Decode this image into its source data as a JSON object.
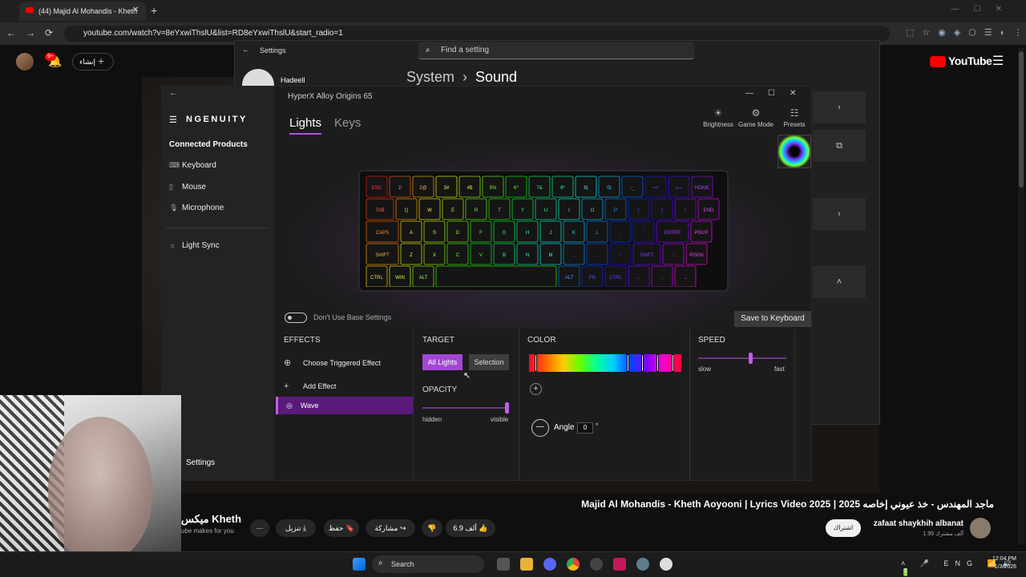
{
  "browser": {
    "tab_title": "(44) Majid Al Mohandis - Kheth",
    "url": "youtube.com/watch?v=8eYxwiThslU&list=RD8eYxwiThslU&start_radio=1"
  },
  "youtube": {
    "logo": "YouTube",
    "create_label": "إنشاء",
    "notif_count": "9+",
    "video_title": "Majid Al Mohandis - Kheth Aoyooni | Lyrics Video 2025 | ماجد المهندس - خذ عيوني إخاصه 2025",
    "channel_name": "zafaat shaykhih albanat",
    "channel_subs": "1.99 ألف مشترك",
    "subscribe": "اشتراك",
    "likes": "6.9 ألف",
    "share": "مشاركة",
    "save": "حفظ",
    "download": "تنزيل",
    "mix_title": "ميكس Kheth",
    "mix_sub": "ube makes for you"
  },
  "settings": {
    "title": "Settings",
    "search_placeholder": "Find a setting",
    "user": "Hadeell",
    "crumb_parent": "System",
    "crumb_current": "Sound"
  },
  "ngenuity": {
    "brand": "NGENUITY",
    "window_title": "HyperX Alloy Origins 65",
    "connected_products": "Connected Products",
    "nav": [
      {
        "label": "Keyboard",
        "icon": "keyboard-icon"
      },
      {
        "label": "Mouse",
        "icon": "mouse-icon"
      },
      {
        "label": "Microphone",
        "icon": "microphone-icon"
      },
      {
        "label": "Light Sync",
        "icon": "light-sync-icon"
      }
    ],
    "settings_label": "Settings",
    "tabs": [
      "Lights",
      "Keys"
    ],
    "tools": [
      "Brightness",
      "Game Mode",
      "Presets"
    ],
    "toggle_label": "Don't Use Base Settings",
    "save_button": "Save to Keyboard",
    "effects": {
      "header": "EFFECTS",
      "choose": "Choose Triggered Effect",
      "add": "Add Effect",
      "selected": "Wave"
    },
    "target": {
      "header": "TARGET",
      "all": "All Lights",
      "selection": "Selection"
    },
    "opacity": {
      "header": "OPACITY",
      "min": "hidden",
      "max": "visible",
      "value": 1.0
    },
    "color": {
      "header": "COLOR",
      "angle_label": "Angle",
      "angle_value": "0",
      "degree": "°"
    },
    "speed": {
      "header": "SPEED",
      "min": "slow",
      "max": "fast",
      "value": 0.6
    },
    "keys": [
      [
        "ESC",
        "1!",
        "2@",
        "3#",
        "4$",
        "5%",
        "6^",
        "7&",
        "8*",
        "9(",
        "0)",
        "-_",
        "=+",
        "⟵",
        "HOME"
      ],
      [
        "TAB",
        "Q",
        "W",
        "E",
        "R",
        "T",
        "Y",
        "U",
        "I",
        "O",
        "P",
        "[",
        "]",
        "\\",
        "END"
      ],
      [
        "CAPS",
        "A",
        "S",
        "D",
        "F",
        "G",
        "H",
        "J",
        "K",
        "L",
        ";",
        "'",
        "ENTER",
        "PGUP"
      ],
      [
        "SHIFT",
        "Z",
        "X",
        "C",
        "V",
        "B",
        "N",
        "M",
        ",",
        ".",
        "/",
        "SHIFT",
        "↑",
        "PGDN"
      ],
      [
        "CTRL",
        "WIN",
        "ALT",
        "",
        "ALT",
        "FN",
        "CTRL",
        "←",
        "↓",
        "→"
      ]
    ]
  },
  "taskbar": {
    "search": "Search",
    "lang": "ENG",
    "time": "12:04 PM",
    "date": "1/3/2026"
  }
}
